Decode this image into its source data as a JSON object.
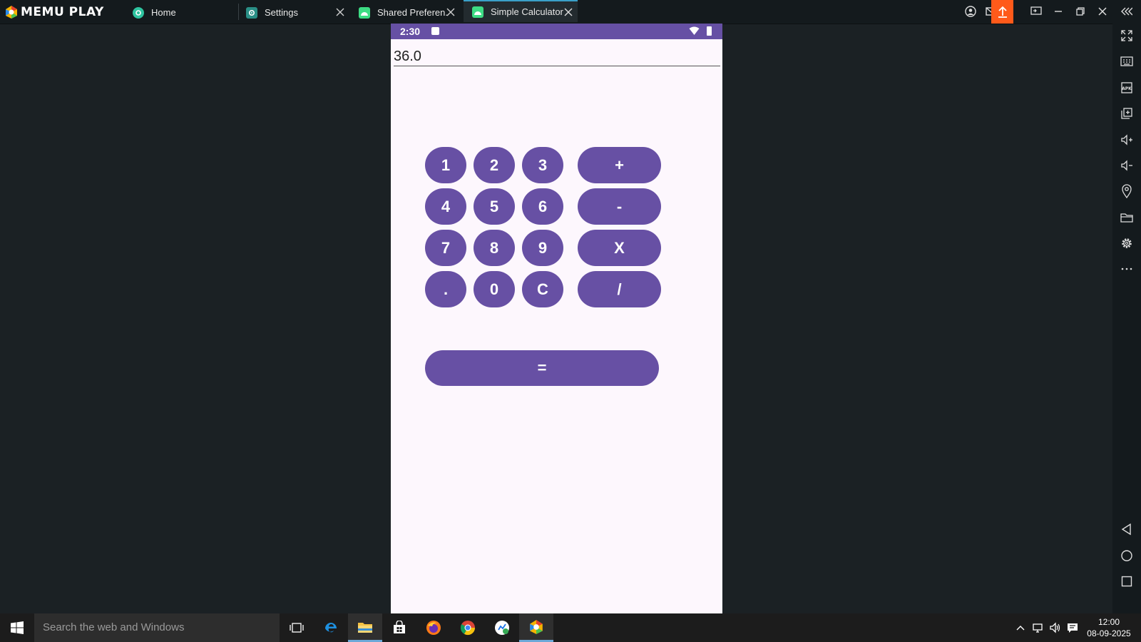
{
  "app": {
    "logo_text": "MEMU PLAY"
  },
  "tabs": [
    {
      "label": "Home",
      "icon": "home-app-icon",
      "color": "#2ec4a0"
    },
    {
      "label": "Settings",
      "icon": "settings-app-icon",
      "color": "#2a8f86"
    },
    {
      "label": "Shared Preferen.",
      "icon": "android-app-icon",
      "color": "#3ddc84"
    },
    {
      "label": "Simple Calculator",
      "icon": "android-app-icon",
      "color": "#3ddc84"
    }
  ],
  "android": {
    "status_time": "2:30",
    "result_text": "36.0",
    "keys": {
      "row1": [
        "1",
        "2",
        "3",
        "+"
      ],
      "row2": [
        "4",
        "5",
        "6",
        "-"
      ],
      "row3": [
        "7",
        "8",
        "9",
        "X"
      ],
      "row4": [
        ".",
        "0",
        "C",
        "/"
      ],
      "equals": "="
    },
    "accent_color": "#6750a4"
  },
  "taskbar": {
    "search_placeholder": "Search the web and Windows",
    "clock_time": "12:00",
    "clock_date": "08-09-2025"
  },
  "colors": {
    "upload_button": "#ff5a1a",
    "active_tab_border": "#3aa0c8"
  }
}
